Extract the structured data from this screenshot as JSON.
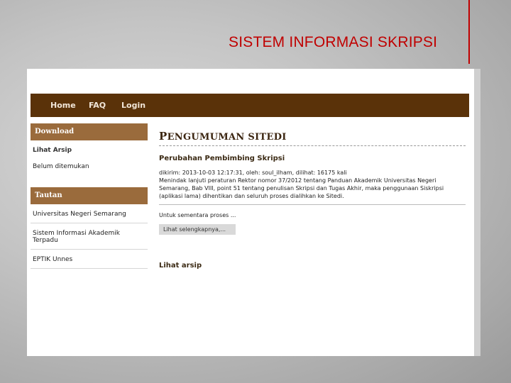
{
  "slide": {
    "title": "SISTEM INFORMASI SKRIPSI"
  },
  "nav": {
    "items": [
      "Home",
      "FAQ",
      "Login"
    ]
  },
  "sidebar": {
    "download_header": "Download",
    "lihat_arsip": "Lihat Arsip",
    "empty_text": "Belum ditemukan",
    "tautan_header": "Tautan",
    "links": [
      "Universitas Negeri Semarang",
      "Sistem Informasi Akademik Terpadu",
      "EPTIK Unnes"
    ]
  },
  "main": {
    "title_first": "P",
    "title_rest": "ENGUMUMAN SITEDI",
    "post_title": "Perubahan Pembimbing Skripsi",
    "post_meta": "dikirim: 2013-10-03 12:17:31, oleh: soul_ilham, dilihat: 16175 kali",
    "post_body": "Menindak lanjuti peraturan Rektor nomor 37/2012 tentang Panduan Akademik Universitas Negeri Semarang, Bab VIII, point 51 tentang penulisan Skripsi dan Tugas Akhir, maka penggunaan Siskripsi (aplikasi lama) dihentikan dan seluruh proses dialihkan ke Sitedi.",
    "post_cont": "Untuk sementara proses ...",
    "more_label": "Lihat selengkapnya,...",
    "archive_label": "Lihat arsip"
  }
}
